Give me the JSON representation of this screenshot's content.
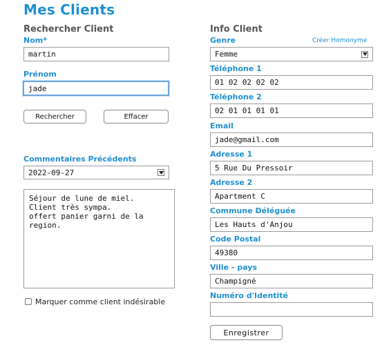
{
  "page": {
    "title": "Mes Clients"
  },
  "search": {
    "section_title": "Rechercher Client",
    "nom_label": "Nom*",
    "nom_value": "martin",
    "prenom_label": "Prénom",
    "prenom_value": "jade",
    "search_button": "Rechercher",
    "clear_button": "Effacer"
  },
  "comments": {
    "label": "Commentaires Précédents",
    "selected_date": "2022-09-27",
    "lines": [
      "Séjour de lune de miel.",
      "Client très sympa.",
      "offert panier garni de la region."
    ],
    "undesirable_label": "Marquer comme client indésirable"
  },
  "info": {
    "section_title": "Info Client",
    "homonyme_link": "Créer Homonyme",
    "genre_label": "Genre",
    "genre_value": "Femme",
    "tel1_label": "Téléphone 1",
    "tel1_value": "01 02 02 02 02",
    "tel2_label": "Téléphone 2",
    "tel2_value": "02 01 01 01 01",
    "email_label": "Email",
    "email_value": "jade@gmail.com",
    "addr1_label": "Adresse 1",
    "addr1_value": "5 Rue Du Pressoir",
    "addr2_label": "Adresse 2",
    "addr2_value": "Apartment C",
    "commune_label": "Commune Déléguée",
    "commune_value": "Les Hauts d'Anjou",
    "cp_label": "Code Postal",
    "cp_value": "49380",
    "ville_label": "Ville - pays",
    "ville_value": "Champigné",
    "id_label": "Numéro d'Identité",
    "id_value": "",
    "save_button": "Enregistrer"
  }
}
